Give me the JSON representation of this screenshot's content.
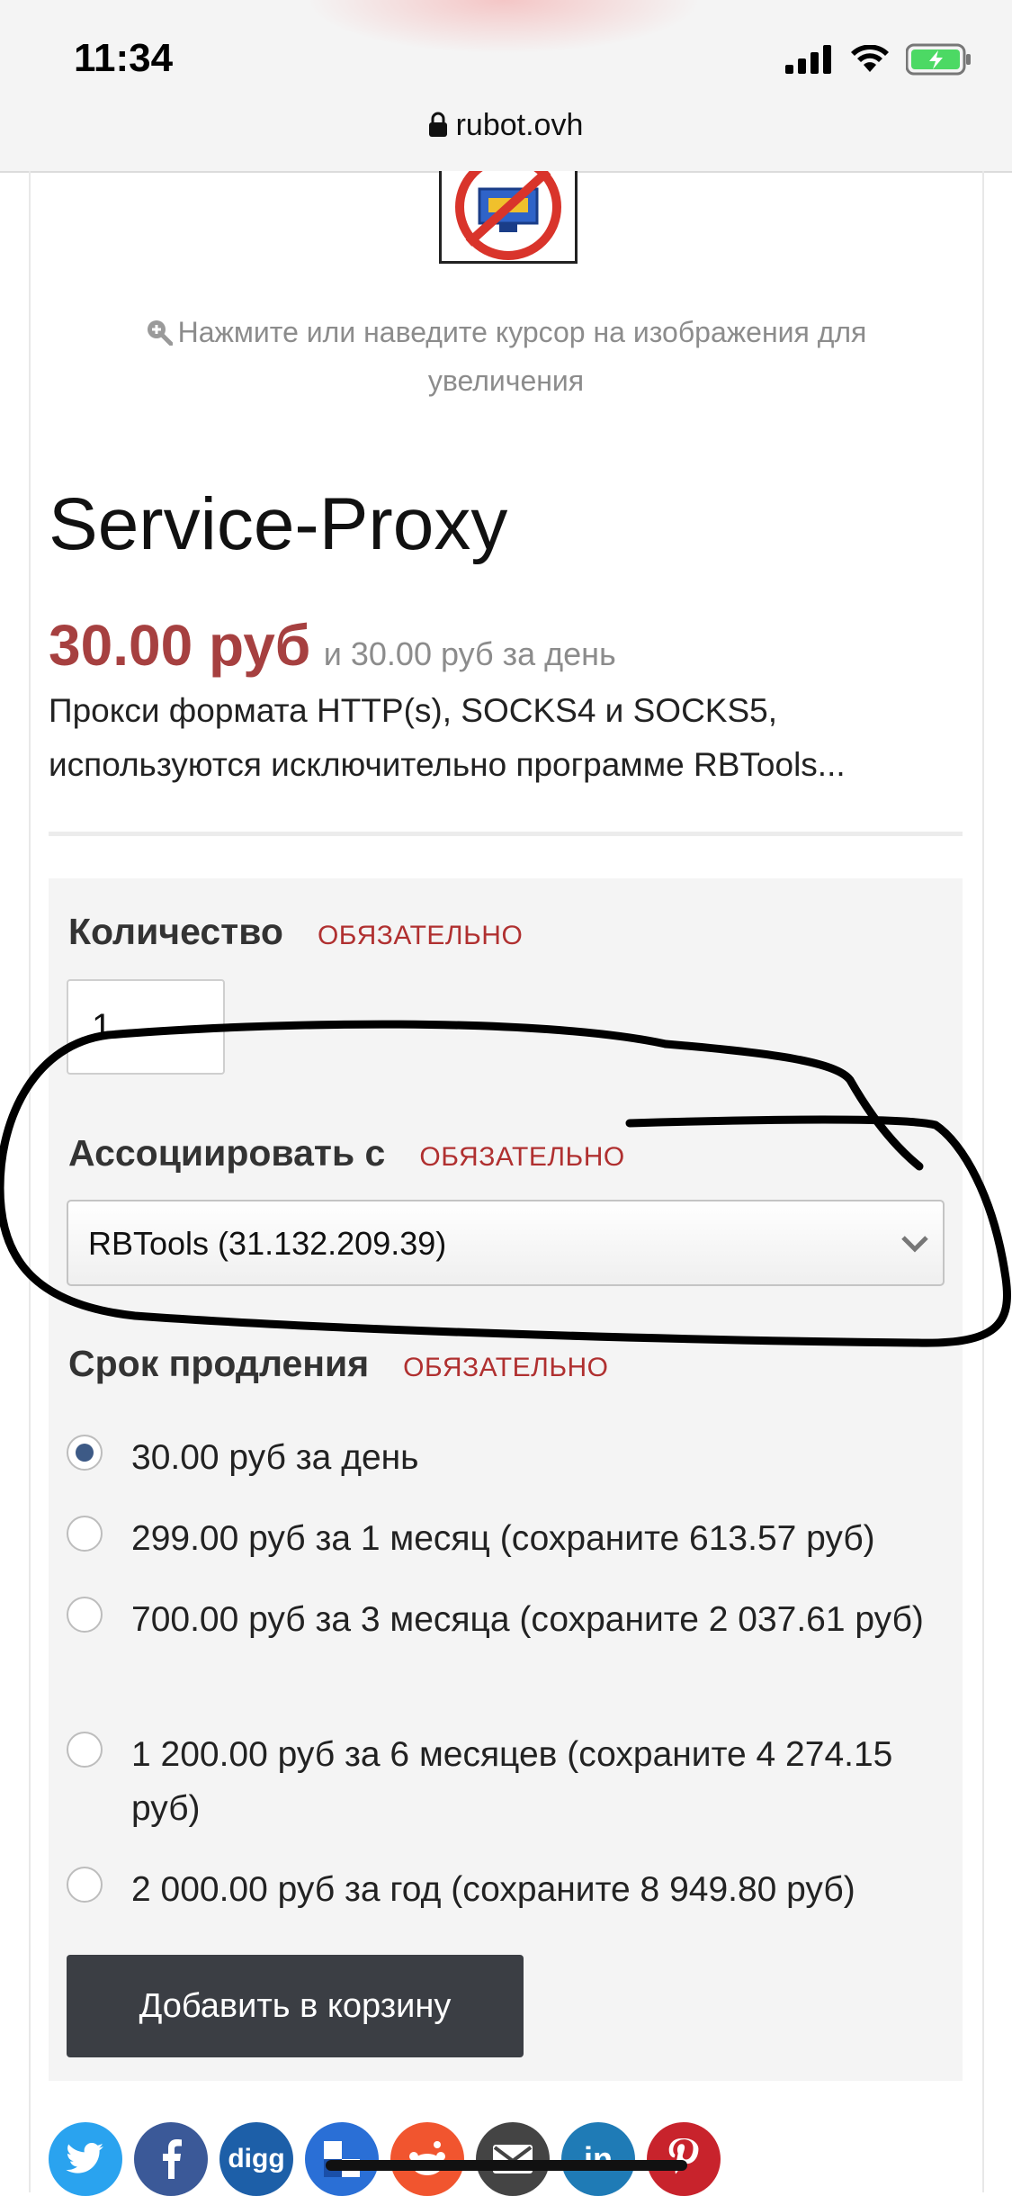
{
  "status_bar": {
    "time": "11:34"
  },
  "browser": {
    "url": "rubot.ovh"
  },
  "product": {
    "zoom_hint": "Нажмите или наведите курсор на изображения для увеличения",
    "title": "Service-Proxy",
    "price": "30.00 руб",
    "price_note": "и 30.00 руб за день",
    "description": "Прокси формата HTTP(s), SOCKS4 и SOCKS5, используются исключительно программе RBTools..."
  },
  "form": {
    "quantity": {
      "label": "Количество",
      "required": "ОБЯЗАТЕЛЬНО",
      "value": "1"
    },
    "associate": {
      "label": "Ассоциировать с",
      "required": "ОБЯЗАТЕЛЬНО",
      "selected": "RBTools (31.132.209.39)"
    },
    "renewal": {
      "label": "Срок продления",
      "required": "ОБЯЗАТЕЛЬНО",
      "options": [
        {
          "label": "30.00 руб за день",
          "selected": true
        },
        {
          "label": "299.00 руб за 1 месяц (сохраните 613.57 руб)",
          "selected": false
        },
        {
          "label": "700.00 руб за 3 месяца (сохраните 2 037.61 руб)",
          "selected": false
        },
        {
          "label": "1 200.00 руб за 6 месяцев (сохраните 4 274.15 руб)",
          "selected": false
        },
        {
          "label": "2 000.00 руб за год (сохраните 8 949.80 руб)",
          "selected": false
        }
      ]
    },
    "add_to_cart": "Добавить в корзину"
  },
  "share": {
    "buttons": [
      {
        "name": "twitter-icon",
        "color": "#2aa3ef"
      },
      {
        "name": "facebook-icon",
        "color": "#3b5998"
      },
      {
        "name": "digg-icon",
        "color": "#1d5fa8",
        "text": "digg"
      },
      {
        "name": "delicious-icon",
        "color": "#2a6fd6"
      },
      {
        "name": "reddit-icon",
        "color": "#f1552f"
      },
      {
        "name": "email-icon",
        "color": "#444444"
      },
      {
        "name": "linkedin-icon",
        "color": "#1f7bb6",
        "text": "in"
      },
      {
        "name": "pinterest-icon",
        "color": "#c8232c"
      }
    ]
  },
  "colors": {
    "price": "#a64040",
    "required": "#b03030",
    "button": "#3b3e44",
    "radio_selected": "#3d5a86",
    "battery": "#4cd964"
  }
}
